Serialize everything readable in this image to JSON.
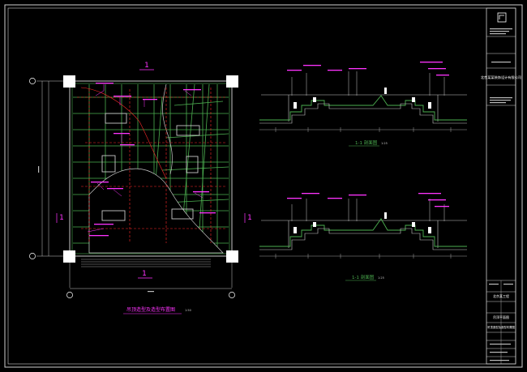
{
  "drawing": {
    "plan": {
      "section_marks": {
        "top": "1",
        "bottom": "1",
        "left": "1",
        "right": "1"
      },
      "title": "吊顶造型及造型布置图",
      "scale": "1:50"
    },
    "sections": [
      {
        "title": "1-1 剖面图",
        "scale": "1:25"
      },
      {
        "title": "1-1 剖面图",
        "scale": "1:25"
      }
    ],
    "title_block": {
      "company": "北京某某装饰设计有限公司",
      "project": "北京某工程",
      "drawing_name": "吊顶平面图",
      "drawing_desc": "吊顶造型及造型布置图"
    },
    "colors": {
      "background": "#000000",
      "frame": "#ffffff",
      "ceiling_grid": "#4caf50",
      "callout": "#ff33ff",
      "dimension": "#c8c8c8",
      "dashed_guide": "#ff2a2a",
      "axis_bubble": "#ffffff"
    }
  }
}
